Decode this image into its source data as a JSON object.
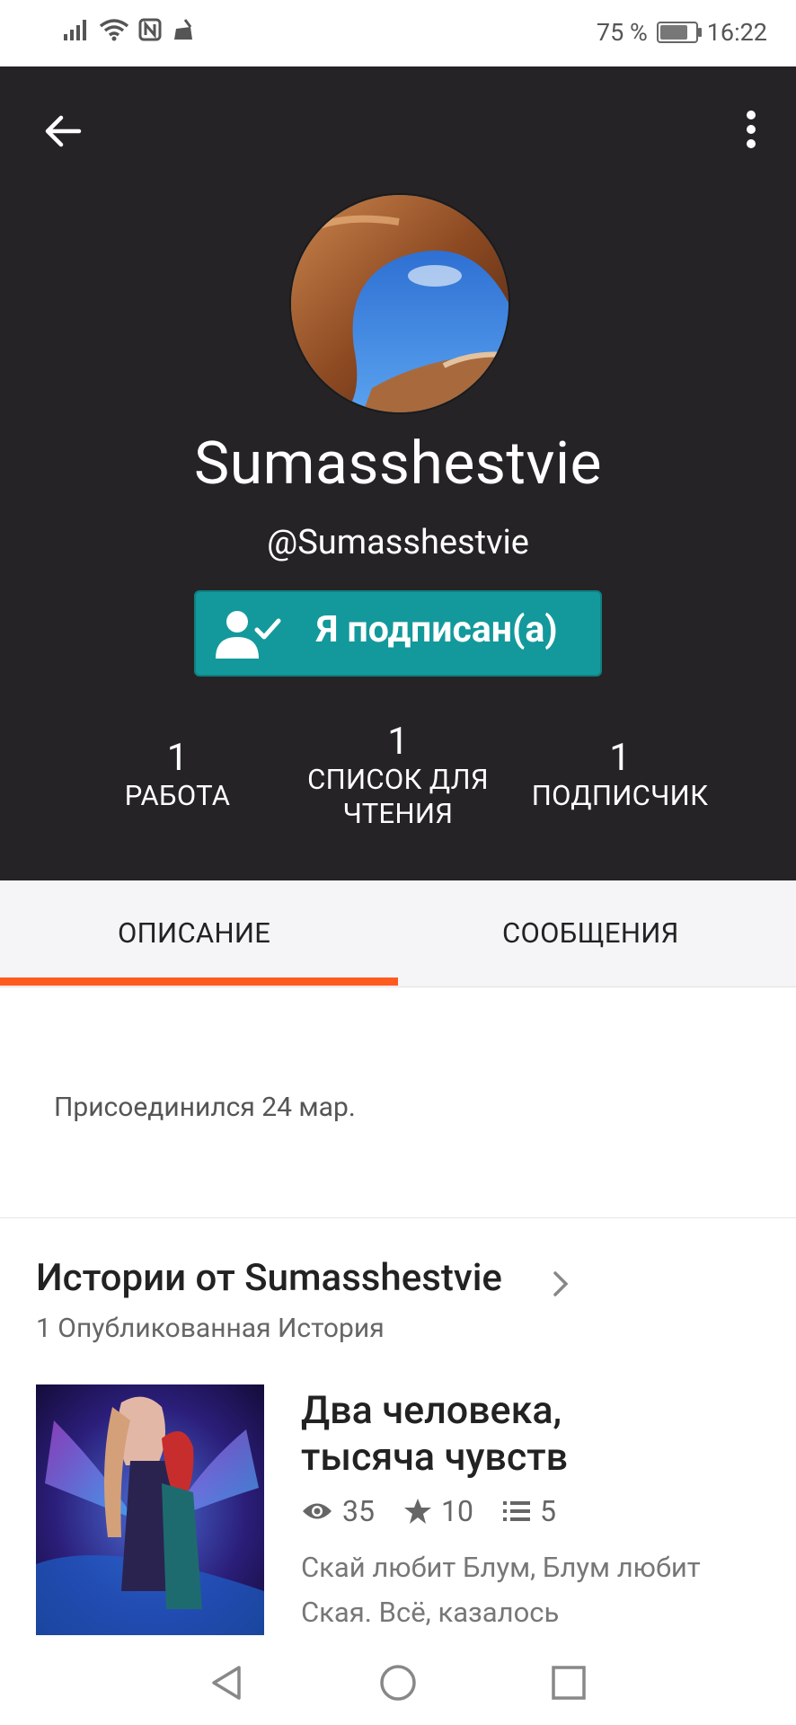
{
  "status": {
    "battery": "75 %",
    "time": "16:22",
    "icons": [
      "signal-icon",
      "wifi-icon",
      "nfc-icon",
      "cleaner-icon"
    ]
  },
  "header": {
    "back_icon": "arrow-back-icon",
    "more_icon": "more-vertical-icon",
    "profile_name": "Sumasshestvie",
    "handle": "@Sumasshestvie",
    "follow_button_label": "Я подписан(а)",
    "follow_icon": "person-check-icon",
    "stats": [
      {
        "value": "1",
        "label": "РАБОТА"
      },
      {
        "value": "1",
        "label": "СПИСОК ДЛЯ ЧТЕНИЯ"
      },
      {
        "value": "1",
        "label": "ПОДПИСЧИК"
      }
    ]
  },
  "tabs": {
    "items": [
      "ОПИСАНИЕ",
      "СООБЩЕНИЯ"
    ],
    "active": "ОПИСАНИЕ",
    "accent": "#ff5a1f"
  },
  "about": {
    "joined": "Присоединился 24 мар."
  },
  "stories": {
    "title": "Истории от Sumasshestvie",
    "count": "1 Опубликованная История",
    "items": [
      {
        "title": "Два человека, тысяча чувств",
        "reads": "35",
        "votes": "10",
        "parts": "5",
        "description": "Скай любит Блум, Блум любит Ская. Всё, казалось"
      }
    ]
  },
  "navbar": {
    "buttons": [
      "nav-back-icon",
      "nav-home-icon",
      "nav-recents-icon"
    ]
  },
  "colors": {
    "header_bg": "#252325",
    "follow_button": "#13999b",
    "tab_indicator": "#ff5a1f"
  }
}
